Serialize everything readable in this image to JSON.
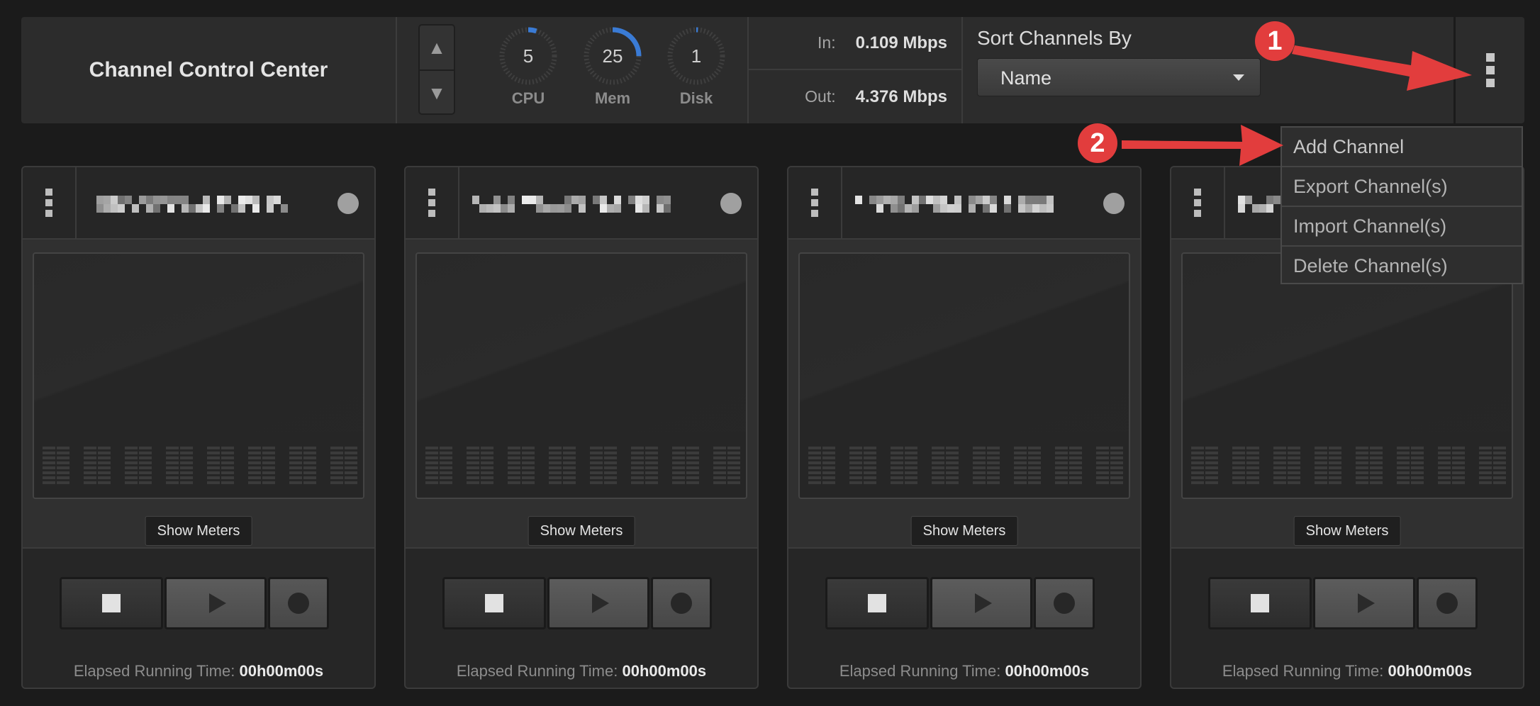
{
  "header": {
    "title": "Channel Control Center",
    "spinner": {
      "up_icon": "triangle-up-icon",
      "down_icon": "triangle-down-icon"
    },
    "gauges": [
      {
        "label": "CPU",
        "value": "5",
        "percent": 5
      },
      {
        "label": "Mem",
        "value": "25",
        "percent": 25
      },
      {
        "label": "Disk",
        "value": "1",
        "percent": 1
      }
    ],
    "bandwidth": {
      "in_label": "In:",
      "in_value": "0.109 Mbps",
      "out_label": "Out:",
      "out_value": "4.376 Mbps"
    },
    "sort": {
      "label": "Sort Channels By",
      "selected": "Name"
    },
    "menu_icon": "vertical-dots-icon"
  },
  "menu": {
    "items": [
      {
        "label": "Add Channel"
      },
      {
        "label": "Export Channel(s)"
      },
      {
        "label": "Import Channel(s)"
      },
      {
        "label": "Delete Channel(s)"
      }
    ]
  },
  "callouts": [
    "1",
    "2"
  ],
  "colors": {
    "accent_red": "#e23d3d",
    "gauge_blue": "#3a7bd5",
    "background": "#1b1b1b"
  },
  "channels": [
    {
      "show_meters_label": "Show Meters",
      "elapsed_label": "Elapsed Running Time:",
      "elapsed_value": "00h00m00s"
    },
    {
      "show_meters_label": "Show Meters",
      "elapsed_label": "Elapsed Running Time:",
      "elapsed_value": "00h00m00s"
    },
    {
      "show_meters_label": "Show Meters",
      "elapsed_label": "Elapsed Running Time:",
      "elapsed_value": "00h00m00s"
    },
    {
      "show_meters_label": "Show Meters",
      "elapsed_label": "Elapsed Running Time:",
      "elapsed_value": "00h00m00s"
    }
  ]
}
